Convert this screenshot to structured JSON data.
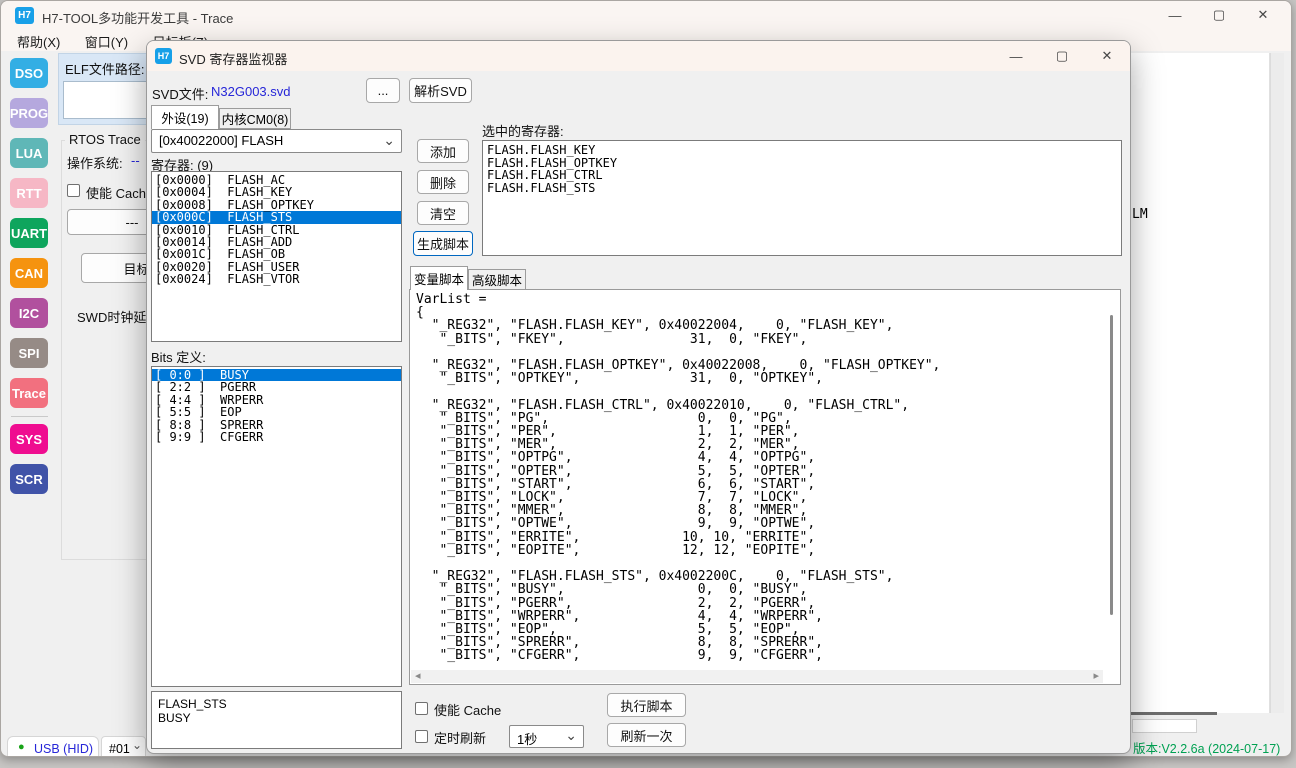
{
  "colors": {
    "selection": "#0078D7",
    "link": "#2727D8",
    "h7_blue": "#18A0E8",
    "focus_blue": "#0067C0",
    "version_green": "#00A152",
    "status_green": "#18A318"
  },
  "icons": {
    "minimize": "—",
    "maximize": "▢",
    "close": "✕",
    "chevron_down": "⌄",
    "scroll_left": "◂",
    "scroll_right": "▸",
    "status_dot": "●"
  },
  "main_window": {
    "logo": "H7",
    "title": "H7-TOOL多功能开发工具 - Trace",
    "menu": [
      "帮助(X)",
      "窗口(Y)",
      "目标板(Z)"
    ],
    "sidebar": [
      {
        "label": "DSO",
        "color": "#33AEE4"
      },
      {
        "label": "PROG",
        "color": "#B5A8DE"
      },
      {
        "label": "LUA",
        "color": "#5FB7B7"
      },
      {
        "label": "RTT",
        "color": "#F6B7C5"
      },
      {
        "label": "UART",
        "color": "#0EA55D"
      },
      {
        "label": "CAN",
        "color": "#F5930F"
      },
      {
        "label": "I2C",
        "color": "#B1509E"
      },
      {
        "label": "SPI",
        "color": "#968B86"
      },
      {
        "label": "Trace",
        "color": "#F2707F"
      },
      {
        "label": "SYS",
        "color": "#EF0D90"
      },
      {
        "label": "SCR",
        "color": "#4053A8"
      }
    ],
    "left_panel": {
      "elf_label": "ELF文件路径: (",
      "rtos_group": "RTOS Trace",
      "os_label": "操作系统:",
      "os_value": "--",
      "cache_label": "使能 Cache",
      "dash_button": "---",
      "screenshot_button": "目标板截屏",
      "swd_label": "SWD时钟延"
    },
    "background_text": "LM",
    "statusbar": {
      "usb_label": "USB (HID)",
      "device": "#01",
      "version": "版本:V2.2.6a (2024-07-17)"
    }
  },
  "dialog": {
    "logo": "H7",
    "title": "SVD 寄存器监视器",
    "svd_label": "SVD文件:",
    "svd_file": "N32G003.svd",
    "browse_button": "...",
    "parse_button": "解析SVD",
    "tabs": [
      "外设(19)",
      "内核CM0(8)"
    ],
    "peripheral_value": "[0x40022000] FLASH",
    "registers_label": "寄存器: (9)",
    "registers": [
      "[0x0000]  FLASH_AC",
      "[0x0004]  FLASH_KEY",
      "[0x0008]  FLASH_OPTKEY",
      "[0x000C]  FLASH_STS",
      "[0x0010]  FLASH_CTRL",
      "[0x0014]  FLASH_ADD",
      "[0x001C]  FLASH_OB",
      "[0x0020]  FLASH_USER",
      "[0x0024]  FLASH_VTOR"
    ],
    "bits_label": "Bits 定义:",
    "bits": [
      "[ 0:0 ]  BUSY",
      "[ 2:2 ]  PGERR",
      "[ 4:4 ]  WRPERR",
      "[ 5:5 ]  EOP",
      "[ 8:8 ]  SPRERR",
      "[ 9:9 ]  CFGERR"
    ],
    "buttons": {
      "add": "添加",
      "remove": "删除",
      "clear": "清空",
      "generate": "生成脚本",
      "execute": "执行脚本",
      "refresh_once": "刷新一次"
    },
    "selected_label": "选中的寄存器:",
    "selected_registers": [
      "FLASH.FLASH_KEY",
      "FLASH.FLASH_OPTKEY",
      "FLASH.FLASH_CTRL",
      "FLASH.FLASH_STS"
    ],
    "script_tabs": [
      "变量脚本",
      "高级脚本"
    ],
    "script_lines": [
      "VarList = ",
      "{",
      "  \"_REG32\", \"FLASH.FLASH_KEY\", 0x40022004,    0, \"FLASH_KEY\", ",
      "   \"_BITS\", \"FKEY\",                31,  0, \"FKEY\", ",
      "",
      "  \"_REG32\", \"FLASH.FLASH_OPTKEY\", 0x40022008,    0, \"FLASH_OPTKEY\", ",
      "   \"_BITS\", \"OPTKEY\",              31,  0, \"OPTKEY\", ",
      "",
      "  \"_REG32\", \"FLASH.FLASH_CTRL\", 0x40022010,    0, \"FLASH_CTRL\", ",
      "   \"_BITS\", \"PG\",                   0,  0, \"PG\", ",
      "   \"_BITS\", \"PER\",                  1,  1, \"PER\", ",
      "   \"_BITS\", \"MER\",                  2,  2, \"MER\", ",
      "   \"_BITS\", \"OPTPG\",                4,  4, \"OPTPG\", ",
      "   \"_BITS\", \"OPTER\",                5,  5, \"OPTER\", ",
      "   \"_BITS\", \"START\",                6,  6, \"START\", ",
      "   \"_BITS\", \"LOCK\",                 7,  7, \"LOCK\", ",
      "   \"_BITS\", \"MMER\",                 8,  8, \"MMER\", ",
      "   \"_BITS\", \"OPTWE\",                9,  9, \"OPTWE\", ",
      "   \"_BITS\", \"ERRITE\",             10, 10, \"ERRITE\", ",
      "   \"_BITS\", \"EOPITE\",             12, 12, \"EOPITE\", ",
      "",
      "  \"_REG32\", \"FLASH.FLASH_STS\", 0x4002200C,    0, \"FLASH_STS\", ",
      "   \"_BITS\", \"BUSY\",                 0,  0, \"BUSY\", ",
      "   \"_BITS\", \"PGERR\",                2,  2, \"PGERR\", ",
      "   \"_BITS\", \"WRPERR\",               4,  4, \"WRPERR\", ",
      "   \"_BITS\", \"EOP\",                  5,  5, \"EOP\", ",
      "   \"_BITS\", \"SPRERR\",               8,  8, \"SPRERR\", ",
      "   \"_BITS\", \"CFGERR\",               9,  9, \"CFGERR\", "
    ],
    "description_lines": [
      "FLASH_STS",
      "BUSY"
    ],
    "cache_label": "使能 Cache",
    "timer_label": "定时刷新",
    "interval_value": "1秒"
  }
}
